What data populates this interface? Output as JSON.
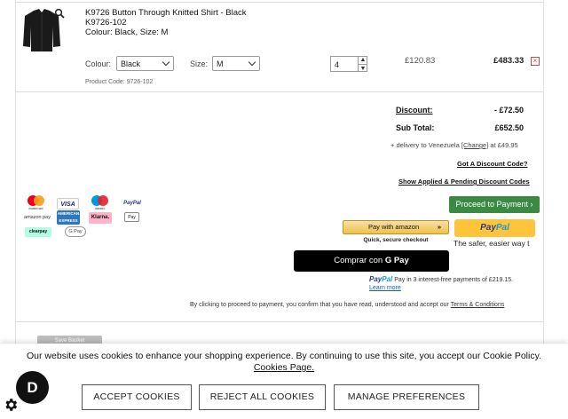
{
  "product": {
    "name": "K9726 Button Through Knitted Shirt - Black",
    "sku": "K9726-102",
    "variant": "Colour: Black, Size: M",
    "colour_label": "Colour:",
    "colour_value": "Black",
    "size_label": "Size:",
    "size_value": "M",
    "quantity": "4",
    "qty_up": "▲",
    "qty_down": "▼",
    "unit_price": "£120.83",
    "line_total": "£483.33",
    "remove_symbol": "×",
    "product_code": "Product Code: 9726-102"
  },
  "totals": {
    "discount_label": "Discount:",
    "discount_value": "- £72.50",
    "subtotal_label": "Sub Total:",
    "subtotal_value": "£652.50",
    "delivery_prefix": "+ delivery to ",
    "delivery_country": "Venezuela",
    "delivery_change": "[Change]",
    "delivery_suffix": " at £49.95",
    "discount_code_link": "Got A Discount Code?",
    "show_codes_link": "Show Applied & Pending Discount Codes"
  },
  "payment_logos": {
    "mastercard": "mastercard",
    "visa": "VISA",
    "maestro": "maestro",
    "paypal": "PayPal",
    "amazonpay": "amazon pay",
    "amex": "AMERICAN EXPRESS",
    "klarna": "Klarna.",
    "applepay": "Pay",
    "clearpay": "clearpay",
    "gpay": "G Pay"
  },
  "checkout": {
    "proceed_label": "Proceed to Payment ›",
    "amazon_label": "Pay with amazon",
    "amazon_sub": "Quick, secure checkout",
    "paypal_part1": "Pay",
    "paypal_part2": "Pal",
    "paypal_sub": "The safer, easier way t",
    "gpay_label": "Comprar con ",
    "gpay_brand": "G Pay",
    "pp_credit_text": " Pay in 3 interest-free payments of £219.15.",
    "learn_more": "Learn more",
    "consent_text": "By clicking to proceed to payment, you confirm that you have read, understood and accept our ",
    "consent_link": "Terms & Conditions",
    "ghost_button": "Save Basket"
  },
  "cookies": {
    "message": "Our website uses cookies to enhance your shopping experience. By continuing to use this site, you accept our Cookie Policy.",
    "link": "Cookies Page.",
    "accept": "ACCEPT COOKIES",
    "reject": "REJECT ALL COOKIES",
    "manage": "MANAGE PREFERENCES"
  },
  "badge": {
    "letter": "D"
  },
  "colors": {
    "proceed_green": "#3a8a44",
    "paypal_yellow": "#ffc439",
    "amazon_gold": "#f0c14b",
    "remove_red": "#c94a4a"
  }
}
